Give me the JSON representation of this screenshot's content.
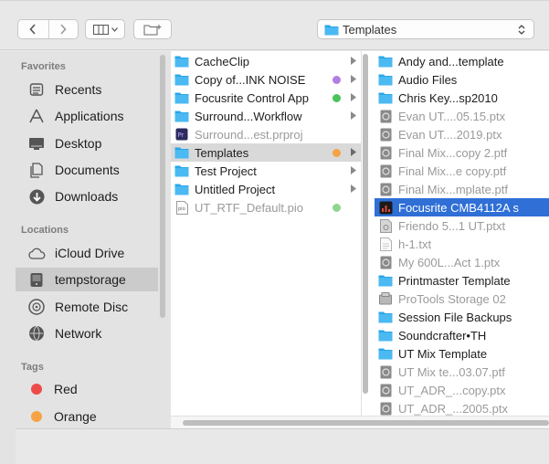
{
  "toolbar": {
    "path_label": "Templates"
  },
  "sidebar": {
    "favorites_heading": "Favorites",
    "favorites": [
      {
        "label": "Recents",
        "icon": "recents-icon"
      },
      {
        "label": "Applications",
        "icon": "applications-icon"
      },
      {
        "label": "Desktop",
        "icon": "desktop-icon"
      },
      {
        "label": "Documents",
        "icon": "documents-icon"
      },
      {
        "label": "Downloads",
        "icon": "downloads-icon"
      }
    ],
    "locations_heading": "Locations",
    "locations": [
      {
        "label": "iCloud Drive",
        "icon": "icloud-icon"
      },
      {
        "label": "tempstorage",
        "icon": "disk-icon",
        "selected": true
      },
      {
        "label": "Remote Disc",
        "icon": "remote-disc-icon"
      },
      {
        "label": "Network",
        "icon": "network-icon"
      }
    ],
    "tags_heading": "Tags",
    "tags": [
      {
        "label": "Red",
        "color": "#ee4b4b"
      },
      {
        "label": "Orange",
        "color": "#f5a345"
      }
    ]
  },
  "column1": {
    "items": [
      {
        "label": "CacheClip",
        "kind": "folder",
        "arrow": true
      },
      {
        "label": "Copy of...INK NOISE",
        "kind": "folder",
        "arrow": true,
        "tag": "#b37ee0"
      },
      {
        "label": "Focusrite Control App",
        "kind": "folder",
        "arrow": true,
        "tag": "#4bc45a"
      },
      {
        "label": "Surround...Workflow",
        "kind": "folder",
        "arrow": true
      },
      {
        "label": "Surround...est.prproj",
        "kind": "prproj",
        "dim": true
      },
      {
        "label": "Templates",
        "kind": "folder",
        "arrow": true,
        "tag": "#f5a345",
        "selected": true
      },
      {
        "label": "Test Project",
        "kind": "folder",
        "arrow": true
      },
      {
        "label": "Untitled Project",
        "kind": "folder",
        "arrow": true
      },
      {
        "label": "UT_RTF_Default.pio",
        "kind": "doc",
        "dim": true,
        "tag": "#8fd68f"
      }
    ]
  },
  "column2": {
    "items": [
      {
        "label": "Andy and...template",
        "kind": "folder"
      },
      {
        "label": "Audio Files",
        "kind": "folder"
      },
      {
        "label": "Chris Key...sp2010",
        "kind": "folder"
      },
      {
        "label": "Evan UT....05.15.ptx",
        "kind": "session",
        "dim": true
      },
      {
        "label": "Evan UT....2019.ptx",
        "kind": "session",
        "dim": true
      },
      {
        "label": "Final Mix...copy 2.ptf",
        "kind": "session",
        "dim": true
      },
      {
        "label": "Final Mix...e copy.ptf",
        "kind": "session",
        "dim": true
      },
      {
        "label": "Final Mix...mplate.ptf",
        "kind": "session",
        "dim": true
      },
      {
        "label": "Focusrite CMB4112A s",
        "kind": "app",
        "selected": true
      },
      {
        "label": "Friendo 5...1 UT.ptxt",
        "kind": "session",
        "dim": true
      },
      {
        "label": "h-1.txt",
        "kind": "text",
        "dim": true
      },
      {
        "label": "My 600L...Act 1.ptx",
        "kind": "session",
        "dim": true
      },
      {
        "label": "Printmaster Template",
        "kind": "folder"
      },
      {
        "label": "ProTools Storage 02",
        "kind": "disk",
        "dim": true
      },
      {
        "label": "Session File Backups",
        "kind": "folder"
      },
      {
        "label": "Soundcrafter•TH",
        "kind": "folder"
      },
      {
        "label": "UT Mix Template",
        "kind": "folder"
      },
      {
        "label": "UT Mix te...03.07.ptf",
        "kind": "session",
        "dim": true
      },
      {
        "label": "UT_ADR_...copy.ptx",
        "kind": "session",
        "dim": true
      },
      {
        "label": "UT_ADR_...2005.ptx",
        "kind": "session",
        "dim": true
      }
    ]
  },
  "colors": {
    "selection_blue": "#2f6fd6",
    "folder_blue": "#2aa6e8",
    "sidebar_bg": "#e3e3e3"
  }
}
